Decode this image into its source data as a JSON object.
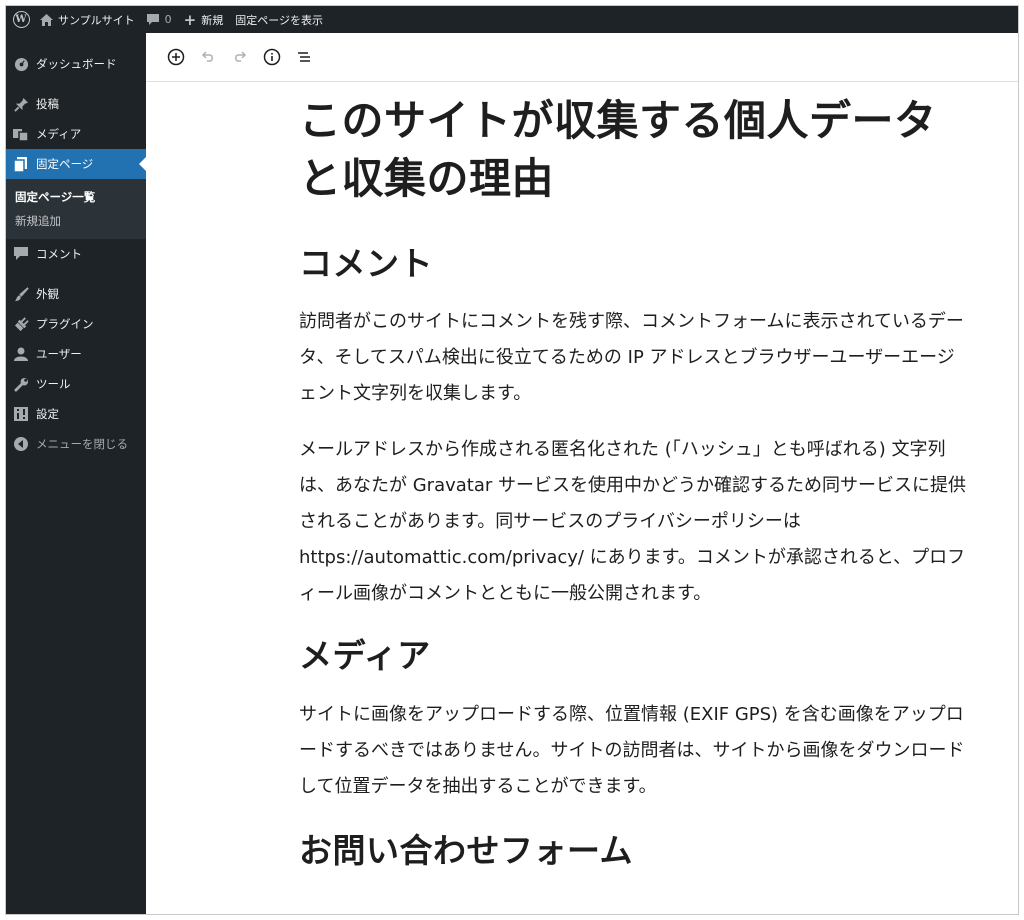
{
  "admin_bar": {
    "site_name": "サンプルサイト",
    "comment_count": "0",
    "new_label": "新規",
    "view_page_label": "固定ページを表示"
  },
  "sidebar": {
    "items": [
      {
        "label": "ダッシュボード",
        "icon": "dashboard-icon"
      },
      {
        "label": "投稿",
        "icon": "pin-icon"
      },
      {
        "label": "メディア",
        "icon": "media-icon"
      },
      {
        "label": "固定ページ",
        "icon": "page-icon",
        "current": true
      },
      {
        "label": "コメント",
        "icon": "comment-icon"
      },
      {
        "label": "外観",
        "icon": "brush-icon"
      },
      {
        "label": "プラグイン",
        "icon": "plugin-icon"
      },
      {
        "label": "ユーザー",
        "icon": "user-icon"
      },
      {
        "label": "ツール",
        "icon": "wrench-icon"
      },
      {
        "label": "設定",
        "icon": "settings-icon"
      },
      {
        "label": "メニューを閉じる",
        "icon": "collapse-icon"
      }
    ],
    "submenu": [
      {
        "label": "固定ページ一覧",
        "active": true
      },
      {
        "label": "新規追加"
      }
    ]
  },
  "toolbar": {
    "icons": [
      "add-block-icon",
      "undo-icon",
      "redo-icon",
      "info-icon",
      "outline-icon"
    ]
  },
  "content": {
    "title": "このサイトが収集する個人データと収集の理由",
    "comment_heading": "コメント",
    "comment_p1": "訪問者がこのサイトにコメントを残す際、コメントフォームに表示されているデータ、そしてスパム検出に役立てるための IP アドレスとブラウザーユーザーエージェント文字列を収集します。",
    "comment_p2": "メールアドレスから作成される匿名化された (「ハッシュ」とも呼ばれる) 文字列は、あなたが Gravatar サービスを使用中かどうか確認するため同サービスに提供されることがあります。同サービスのプライバシーポリシーは https://automattic.com/privacy/ にあります。コメントが承認されると、プロフィール画像がコメントとともに一般公開されます。",
    "media_heading": "メディア",
    "media_p1": "サイトに画像をアップロードする際、位置情報 (EXIF GPS) を含む画像をアップロードするべきではありません。サイトの訪問者は、サイトから画像をダウンロードして位置データを抽出することができます。",
    "contact_heading": "お問い合わせフォーム"
  },
  "colors": {
    "admin_dark": "#1d2327",
    "accent_blue": "#2271b1",
    "submenu_bg": "#2c3338"
  }
}
